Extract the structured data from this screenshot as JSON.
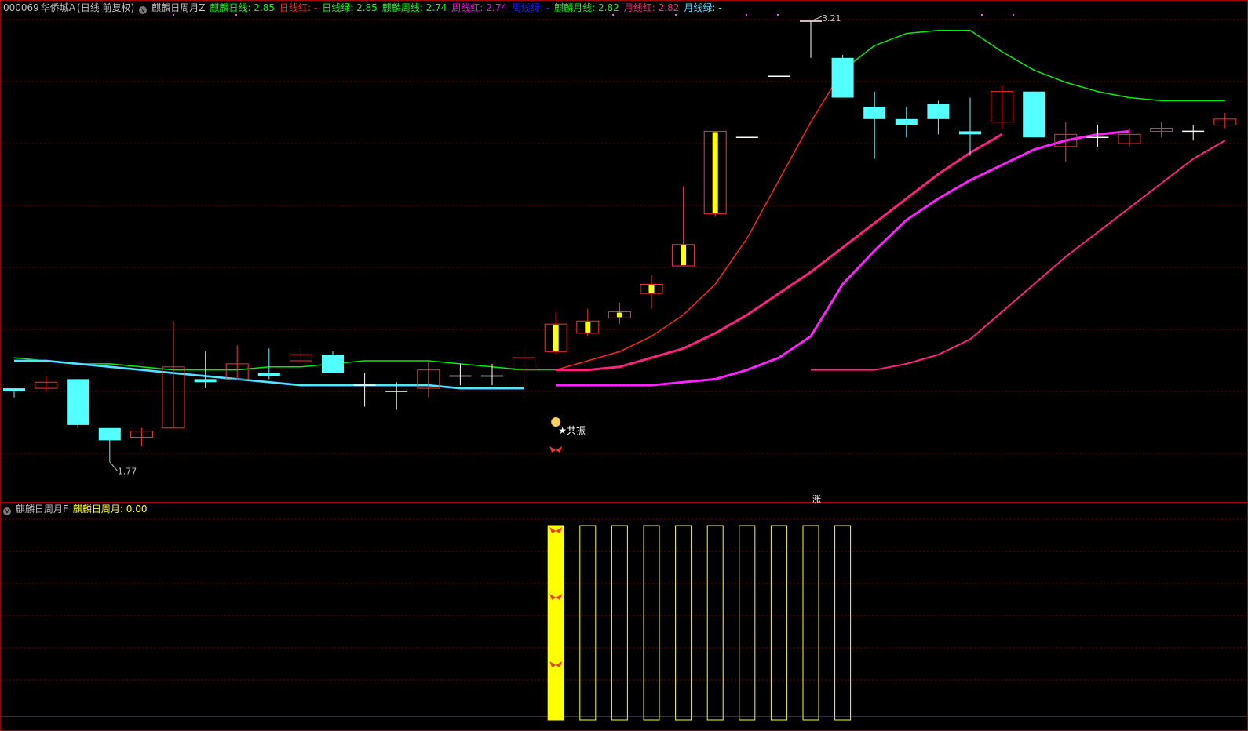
{
  "main_panel": {
    "stock_code": "000069",
    "stock_name": "华侨城A",
    "period": "(日线 前复权)",
    "indicator_name": "麒麟日周月Z",
    "items": [
      {
        "label": "麒麟日线: 2.85",
        "color": "#00ff00"
      },
      {
        "label": "日线红: -",
        "color": "#ff2020"
      },
      {
        "label": "日线绿: 2.85",
        "color": "#00ff00"
      },
      {
        "label": "麒麟周线: 2.74",
        "color": "#00ff00"
      },
      {
        "label": "周线红: 2.74",
        "color": "#ff00ff"
      },
      {
        "label": "周线绿: -",
        "color": "#2020ff"
      },
      {
        "label": "麒麟月线: 2.82",
        "color": "#00ff00"
      },
      {
        "label": "月线红: 2.82",
        "color": "#ff2080"
      },
      {
        "label": "月线绿: -",
        "color": "#40e0ff"
      }
    ],
    "high_label": "3.21",
    "low_label": "1.77",
    "signal_text": "★共振",
    "zhang_marker": "涨"
  },
  "sub_panel": {
    "indicator_name": "麒麟日周月F",
    "value_label": "麒麟日周月: 0.00",
    "value_color": "#ffff00"
  },
  "colors": {
    "grid": "#7a0000",
    "border": "#a00000",
    "up_candle": "#ff3030",
    "down_candle": "#54ffff",
    "day_line_red": "#ff2020",
    "day_line_green": "#00ee00",
    "week_line_magenta": "#ff20ff",
    "month_line_pink": "#ff2080",
    "blue_line": "#2030ff",
    "cyan_line": "#50e8e8",
    "signal_bar": "#ffff00"
  },
  "chart_data": {
    "type": "candlestick",
    "candles": [
      {
        "o": 2.01,
        "c": 2.0,
        "h": 2.01,
        "l": 1.98
      },
      {
        "o": 2.01,
        "c": 2.03,
        "h": 2.05,
        "l": 2.0
      },
      {
        "o": 2.04,
        "c": 1.89,
        "h": 2.04,
        "l": 1.88
      },
      {
        "o": 1.88,
        "c": 1.84,
        "h": 1.88,
        "l": 1.77
      },
      {
        "o": 1.85,
        "c": 1.87,
        "h": 1.88,
        "l": 1.82
      },
      {
        "o": 1.88,
        "c": 2.08,
        "h": 2.23,
        "l": 1.88
      },
      {
        "o": 2.04,
        "c": 2.03,
        "h": 2.13,
        "l": 2.01
      },
      {
        "o": 2.04,
        "c": 2.09,
        "h": 2.15,
        "l": 2.04
      },
      {
        "o": 2.06,
        "c": 2.05,
        "h": 2.14,
        "l": 2.04
      },
      {
        "o": 2.1,
        "c": 2.12,
        "h": 2.14,
        "l": 2.09
      },
      {
        "o": 2.12,
        "c": 2.06,
        "h": 2.13,
        "l": 2.06
      },
      {
        "o": 2.02,
        "c": 2.02,
        "h": 2.06,
        "l": 1.95
      },
      {
        "o": 2.0,
        "c": 2.0,
        "h": 2.03,
        "l": 1.94
      },
      {
        "o": 2.01,
        "c": 2.07,
        "h": 2.1,
        "l": 1.98
      },
      {
        "o": 2.05,
        "c": 2.05,
        "h": 2.09,
        "l": 2.02
      },
      {
        "o": 2.05,
        "c": 2.05,
        "h": 2.09,
        "l": 2.02
      },
      {
        "o": 2.07,
        "c": 2.11,
        "h": 2.14,
        "l": 1.98
      },
      {
        "o": 2.13,
        "c": 2.22,
        "h": 2.26,
        "l": 2.12
      },
      {
        "o": 2.19,
        "c": 2.23,
        "h": 2.27,
        "l": 2.18
      },
      {
        "o": 2.24,
        "c": 2.26,
        "h": 2.29,
        "l": 2.22
      },
      {
        "o": 2.32,
        "c": 2.35,
        "h": 2.38,
        "l": 2.27
      },
      {
        "o": 2.41,
        "c": 2.48,
        "h": 2.67,
        "l": 2.41
      },
      {
        "o": 2.58,
        "c": 2.85,
        "h": 2.85,
        "l": 2.57
      },
      {
        "o": 2.83,
        "c": 2.83,
        "h": 2.83,
        "l": 2.83
      },
      {
        "o": 3.03,
        "c": 3.03,
        "h": 3.03,
        "l": 3.03
      },
      {
        "o": 3.21,
        "c": 3.21,
        "h": 3.21,
        "l": 3.09
      },
      {
        "o": 3.09,
        "c": 2.96,
        "h": 3.1,
        "l": 2.96
      },
      {
        "o": 2.93,
        "c": 2.89,
        "h": 2.98,
        "l": 2.76
      },
      {
        "o": 2.89,
        "c": 2.87,
        "h": 2.93,
        "l": 2.83
      },
      {
        "o": 2.94,
        "c": 2.89,
        "h": 2.95,
        "l": 2.84
      },
      {
        "o": 2.85,
        "c": 2.84,
        "h": 2.96,
        "l": 2.77
      },
      {
        "o": 2.88,
        "c": 2.98,
        "h": 3.0,
        "l": 2.86
      },
      {
        "o": 2.98,
        "c": 2.83,
        "h": 2.98,
        "l": 2.83
      },
      {
        "o": 2.8,
        "c": 2.84,
        "h": 2.88,
        "l": 2.75
      },
      {
        "o": 2.83,
        "c": 2.83,
        "h": 2.87,
        "l": 2.8
      },
      {
        "o": 2.81,
        "c": 2.84,
        "h": 2.86,
        "l": 2.8
      },
      {
        "o": 2.85,
        "c": 2.86,
        "h": 2.88,
        "l": 2.83
      },
      {
        "o": 2.85,
        "c": 2.85,
        "h": 2.87,
        "l": 2.82
      },
      {
        "o": 2.87,
        "c": 2.89,
        "h": 2.91,
        "l": 2.86
      }
    ],
    "series": [
      {
        "values": [
          2.11,
          2.1,
          2.09,
          2.09,
          2.08,
          2.07,
          2.07,
          2.07,
          2.08,
          2.08,
          2.09,
          2.1,
          2.1,
          2.1,
          2.09,
          2.08,
          2.07,
          2.07,
          2.1,
          2.13,
          2.18,
          2.25,
          2.35,
          2.5,
          2.69,
          2.88,
          3.05,
          3.13,
          3.17,
          3.18,
          3.18,
          3.11,
          3.05,
          3.01,
          2.98,
          2.96,
          2.95,
          2.95,
          2.95
        ]
      },
      {
        "values": [
          2.1,
          2.1,
          2.09,
          2.08,
          2.07,
          2.06,
          2.05,
          2.04,
          2.03,
          2.02,
          2.02,
          2.02,
          2.02,
          2.02,
          2.01,
          2.01,
          2.01,
          2.02,
          2.02,
          2.02,
          2.02,
          2.03,
          2.04,
          2.07,
          2.11,
          2.18,
          2.35,
          2.46,
          2.56,
          2.63,
          2.69,
          2.74,
          2.79,
          2.82,
          2.84,
          2.85
        ]
      },
      {
        "values": [
          2.07,
          2.07,
          2.07,
          2.09,
          2.12,
          2.17,
          2.26,
          2.35,
          2.44,
          2.52,
          2.6,
          2.68,
          2.76,
          2.82
        ]
      },
      {
        "values": [
          2.07,
          2.07,
          2.08,
          2.11,
          2.14,
          2.19,
          2.25,
          2.32,
          2.39,
          2.47,
          2.55,
          2.63,
          2.71,
          2.78,
          2.84
        ]
      }
    ]
  }
}
